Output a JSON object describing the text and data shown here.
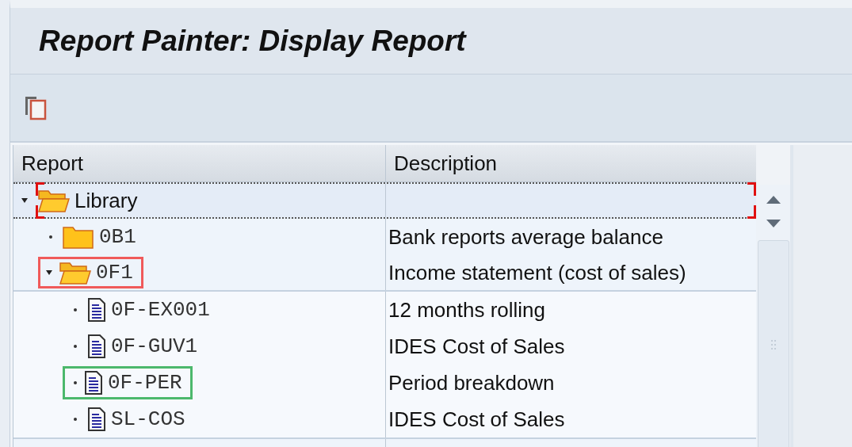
{
  "window": {
    "title": "Report Painter: Display Report"
  },
  "table": {
    "columns": [
      "Report",
      "Description"
    ],
    "rows": [
      {
        "kind": "folder",
        "name": "Library",
        "description": "",
        "expanded": true,
        "selected": true,
        "children": [
          {
            "kind": "folder",
            "name": "0B1",
            "description": "Bank reports average balance",
            "expanded": false,
            "selected": false
          },
          {
            "kind": "folder",
            "name": "0F1",
            "description": "Income statement (cost of sales)",
            "expanded": true,
            "selected": false,
            "color": "#f05a5a",
            "children": [
              {
                "kind": "report",
                "name": "0F-EX001",
                "description": "12 months rolling",
                "selected": false
              },
              {
                "kind": "report",
                "name": "0F-GUV1",
                "description": "IDES Cost of Sales",
                "selected": false
              },
              {
                "kind": "report",
                "name": "0F-PER",
                "description": "Period breakdown",
                "selected": false,
                "color": "#4cb86c"
              },
              {
                "kind": "report",
                "name": "SL-COS",
                "description": "IDES Cost of Sales",
                "selected": false
              }
            ]
          }
        ]
      }
    ]
  }
}
